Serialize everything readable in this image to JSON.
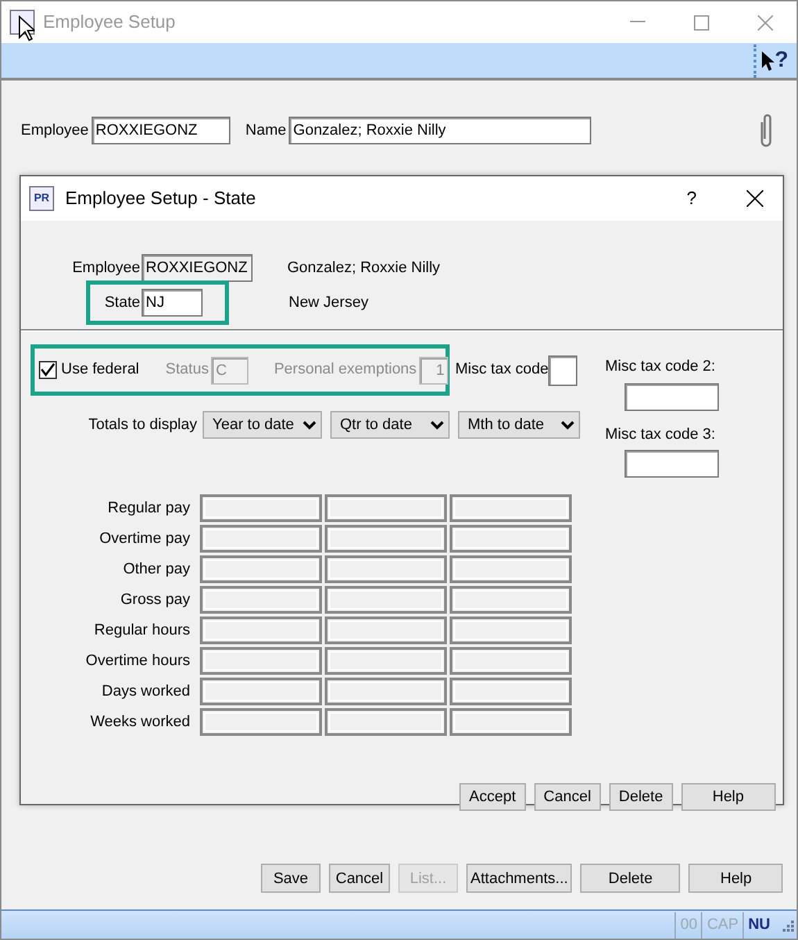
{
  "window": {
    "title": "Employee Setup"
  },
  "toolbar": {
    "help_text": "?"
  },
  "header": {
    "employee_label": "Employee",
    "employee_value": "ROXXIEGONZ",
    "name_label": "Name",
    "name_value": "Gonzalez; Roxxie Nilly"
  },
  "dialog": {
    "icon_text": "PR",
    "title": "Employee Setup - State",
    "help_text": "?",
    "employee_label": "Employee",
    "employee_value": "ROXXIEGONZ",
    "employee_name": "Gonzalez; Roxxie Nilly",
    "state_label": "State",
    "state_value": "NJ",
    "state_name": "New Jersey",
    "state_highlighted": true,
    "federal_highlighted": true,
    "use_federal": {
      "label": "Use federal",
      "checked": true
    },
    "status": {
      "label": "Status",
      "value": "C",
      "disabled": true
    },
    "personal_exemptions": {
      "label": "Personal exemptions",
      "value": "1",
      "disabled": true
    },
    "misc_tax_code": {
      "label": "Misc tax code"
    },
    "misc_tax_code_2": {
      "label": "Misc tax code 2:"
    },
    "misc_tax_code_3": {
      "label": "Misc tax code 3:"
    },
    "totals_label": "Totals to display",
    "totals_selects": [
      "Year to date",
      "Qtr to date",
      "Mth to date"
    ],
    "rows": [
      "Regular pay",
      "Overtime pay",
      "Other pay",
      "Gross pay",
      "Regular hours",
      "Overtime hours",
      "Days worked",
      "Weeks worked"
    ],
    "buttons": [
      {
        "label": "Accept",
        "disabled": false
      },
      {
        "label": "Cancel",
        "disabled": false
      },
      {
        "label": "Delete",
        "disabled": false
      },
      {
        "label": "Help",
        "disabled": false
      }
    ]
  },
  "buttons": [
    {
      "label": "Save",
      "disabled": false
    },
    {
      "label": "Cancel",
      "disabled": false
    },
    {
      "label": "List...",
      "disabled": true
    },
    {
      "label": "Attachments...",
      "disabled": false
    },
    {
      "label": "Delete",
      "disabled": false
    },
    {
      "label": "Help",
      "disabled": false
    }
  ],
  "status_bar": [
    {
      "text": "00",
      "on": false
    },
    {
      "text": "CAP",
      "on": false
    },
    {
      "text": "NU",
      "on": true
    }
  ]
}
